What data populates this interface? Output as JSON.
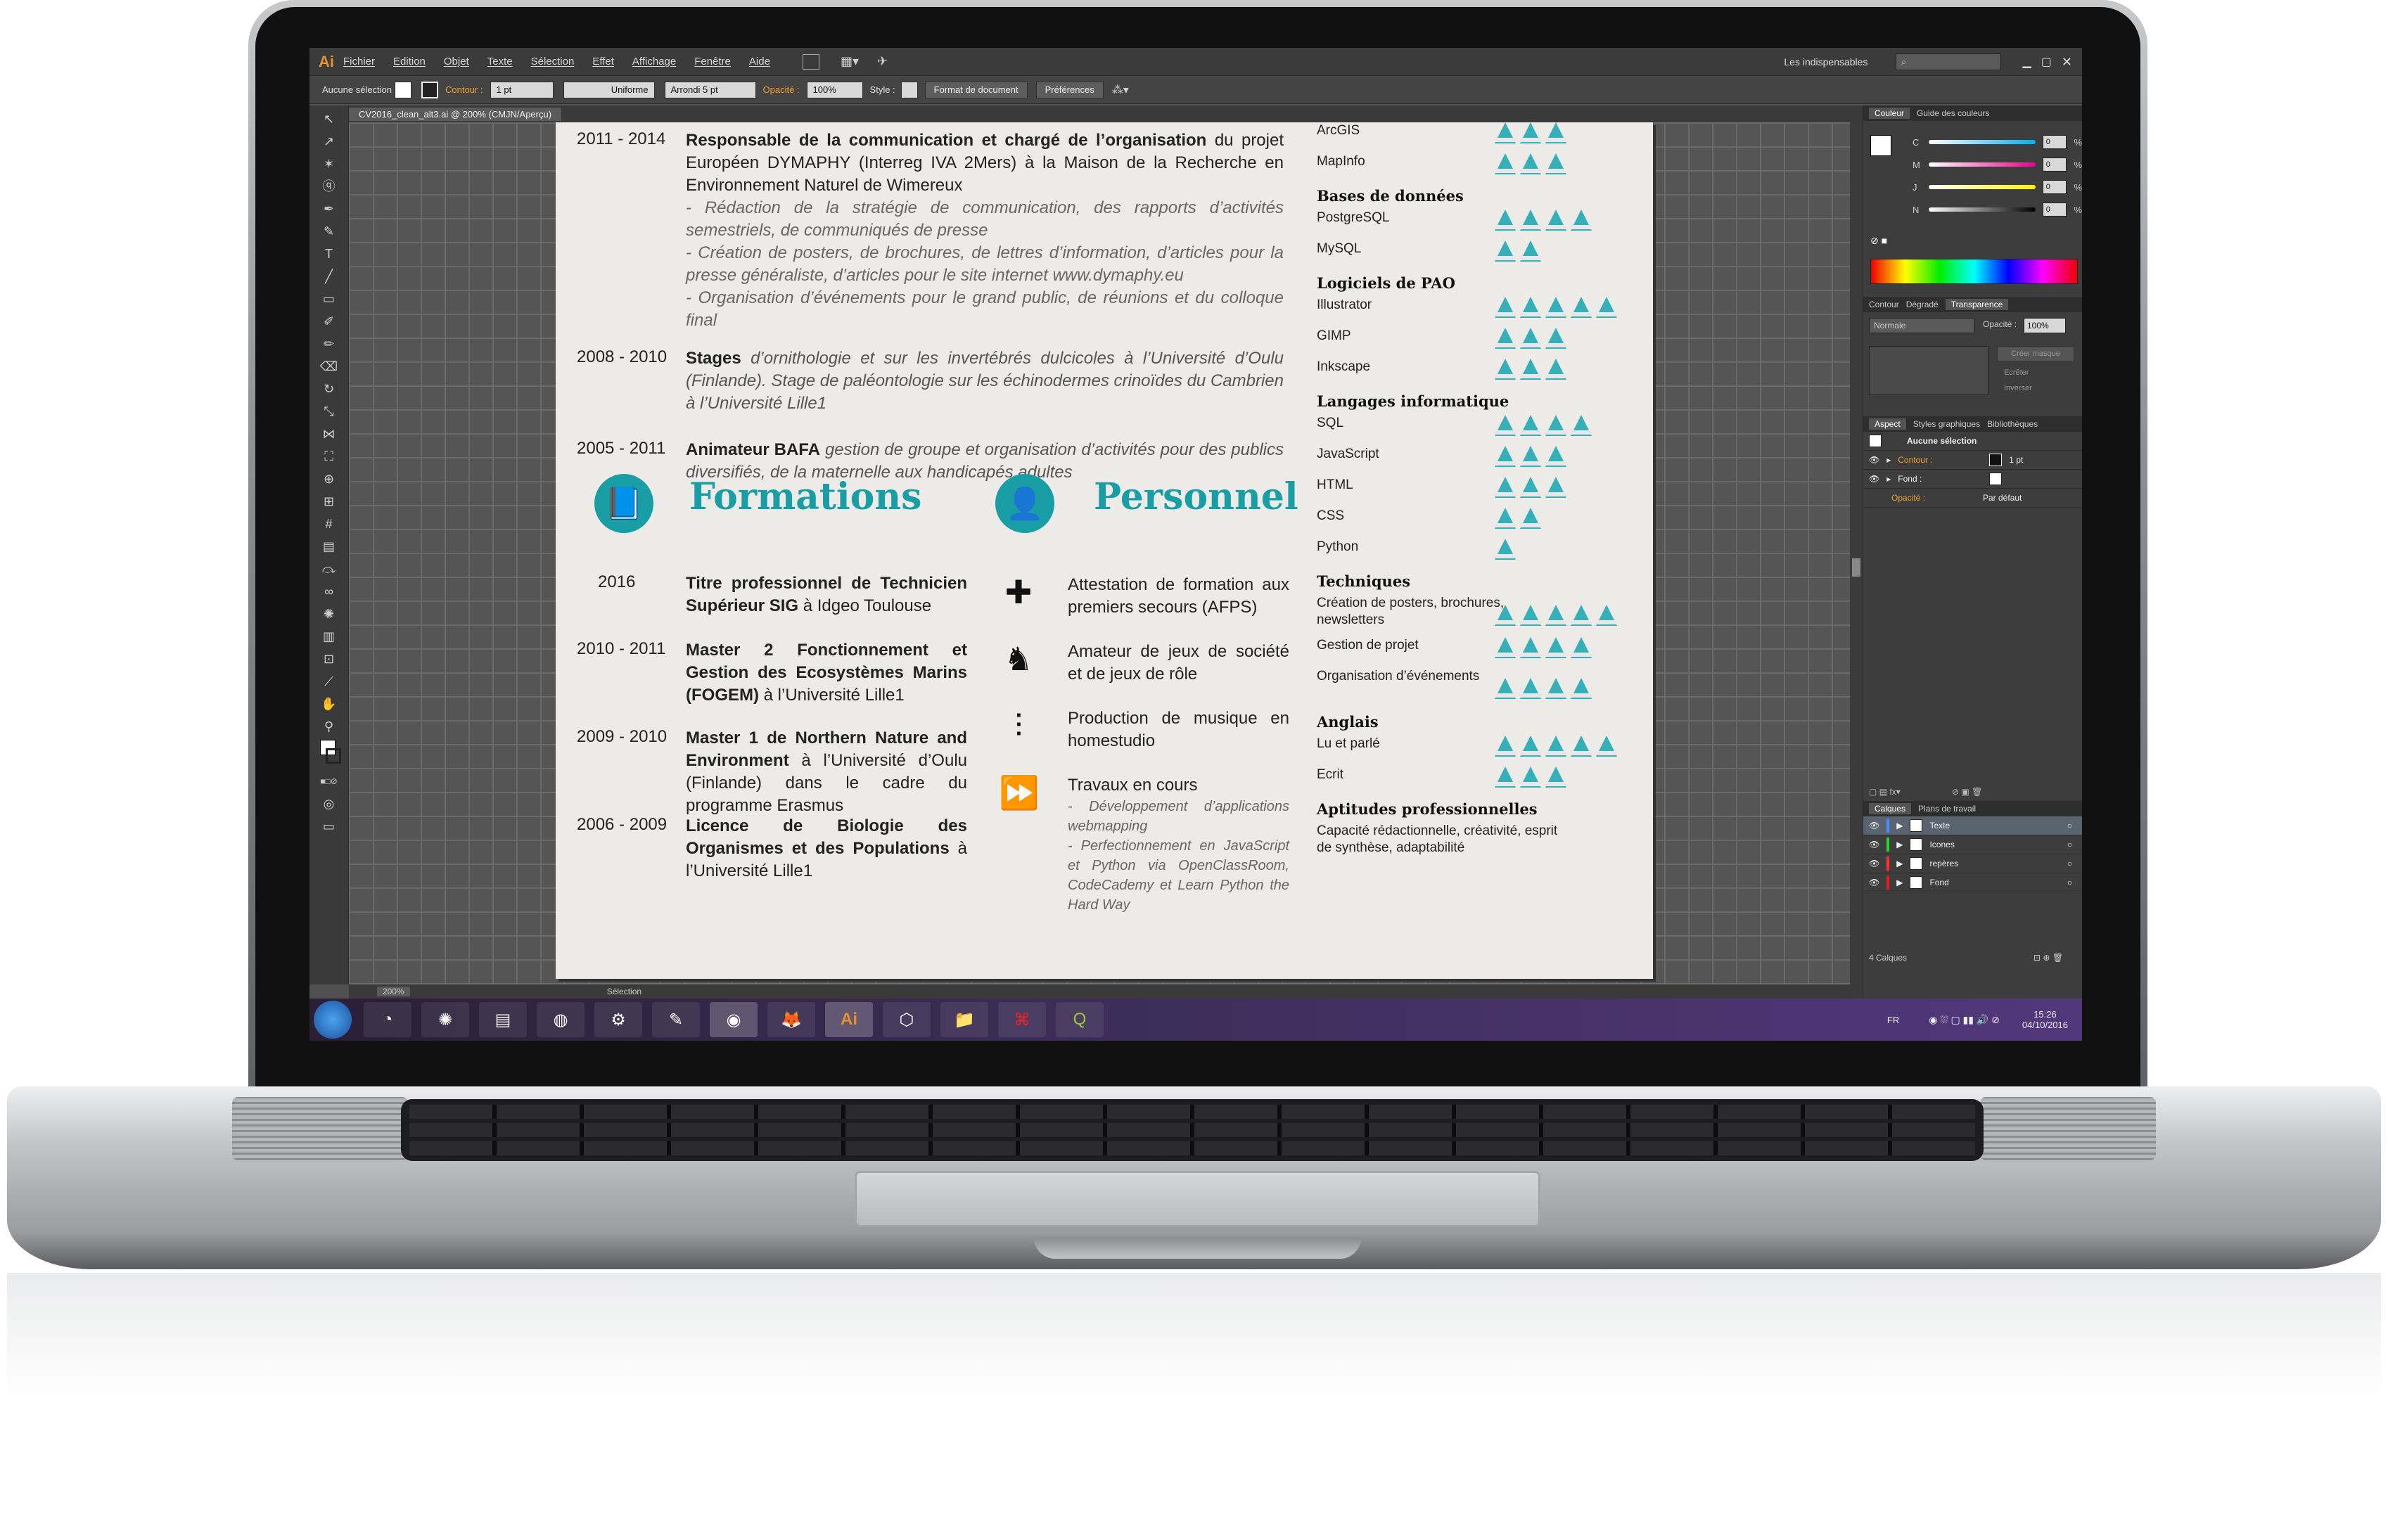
{
  "app": {
    "logo": "Ai",
    "menu": [
      "Fichier",
      "Edition",
      "Objet",
      "Texte",
      "Sélection",
      "Effet",
      "Affichage",
      "Fenêtre",
      "Aide"
    ],
    "workspace": "Les indispensables"
  },
  "control": {
    "selection": "Aucune sélection",
    "stroke_label": "Contour :",
    "stroke_weight": "1 pt",
    "profile": "Uniforme",
    "brush": "Arrondi 5 pt",
    "opacity_label": "Opacité :",
    "opacity": "100%",
    "style_label": "Style :",
    "doc_button": "Format de document",
    "prefs_button": "Préférences"
  },
  "document": {
    "tab": "CV2016_clean_alt3.ai @ 200% (CMJN/Aperçu)"
  },
  "status": {
    "zoom": "200%",
    "tool": "Sélection"
  },
  "cv": {
    "experience": [
      {
        "years": "2011 - 2014",
        "bold": "Responsable de la communication et chargé de l’organisation",
        "text": " du projet Européen DYMAPHY (Interreg IVA 2Mers) à la Maison de la Recherche en Environnement Naturel de Wimereux",
        "details": [
          "- Rédaction de la stratégie de communication, des rapports d’activités semestriels, de communiqués de presse",
          "- Création de posters, de brochures, de lettres d’information, d’articles pour la presse généraliste, d’articles pour le site internet www.dymaphy.eu",
          "- Organisation d’événements pour le grand public, de réunions et du colloque final"
        ]
      },
      {
        "years": "2008 - 2010",
        "bold": "Stages",
        "text": " d’ornithologie et sur les invertébrés dulcicoles à l’Université d’Oulu (Finlande). Stage de paléontologie sur les échinodermes crinoïdes du Cambrien à l’Université Lille1",
        "details": []
      },
      {
        "years": "2005 - 2011",
        "bold": "Animateur BAFA",
        "text": " gestion de groupe et organisation d’activités pour des publics diversifiés, de la maternelle aux handicapés adultes",
        "details": []
      }
    ],
    "formations_title": "Formations",
    "formations": [
      {
        "years": "2016",
        "bold": "Titre professionnel de Technicien Supérieur SIG",
        "text": " à Idgeo Toulouse"
      },
      {
        "years": "2010 - 2011",
        "bold": "Master 2 Fonctionnement et Gestion des Ecosystèmes Marins (FOGEM)",
        "text": " à l’Université Lille1"
      },
      {
        "years": "2009 - 2010",
        "bold": "Master 1 de Northern Nature and Environment",
        "text": " à l’Université d’Oulu (Finlande) dans le cadre du programme Erasmus"
      },
      {
        "years": "2006 - 2009",
        "bold": "Licence de Biologie des Organismes et des Populations",
        "text": " à l’Université Lille1"
      }
    ],
    "personnel_title": "Personnel",
    "personnel": [
      {
        "icon": "first-aid-icon",
        "text": "Attestation de formation aux premiers secours (AFPS)"
      },
      {
        "icon": "chess-knight-icon",
        "text": "Amateur de jeux de société et de jeux de rôle"
      },
      {
        "icon": "mixer-icon",
        "text": "Production de musique en homestudio"
      },
      {
        "icon": "fast-forward-icon",
        "text": "Travaux en cours",
        "details": [
          "- Développement d’applications webmapping",
          "- Perfectionnement en JavaScript et Python via OpenClassRoom, CodeCademy et Learn Python the Hard Way"
        ]
      }
    ],
    "skills": [
      {
        "type": "item",
        "label": "ArcGIS",
        "level": 3
      },
      {
        "type": "item",
        "label": "MapInfo",
        "level": 3
      },
      {
        "type": "heading",
        "label": "Bases de données"
      },
      {
        "type": "item",
        "label": "PostgreSQL",
        "level": 4
      },
      {
        "type": "item",
        "label": "MySQL",
        "level": 2
      },
      {
        "type": "heading",
        "label": "Logiciels de PAO"
      },
      {
        "type": "item",
        "label": "Illustrator",
        "level": 5
      },
      {
        "type": "item",
        "label": "GIMP",
        "level": 3
      },
      {
        "type": "item",
        "label": "Inkscape",
        "level": 3
      },
      {
        "type": "heading",
        "label": "Langages informatique"
      },
      {
        "type": "item",
        "label": "SQL",
        "level": 4
      },
      {
        "type": "item",
        "label": "JavaScript",
        "level": 3
      },
      {
        "type": "item",
        "label": "HTML",
        "level": 3
      },
      {
        "type": "item",
        "label": "CSS",
        "level": 2
      },
      {
        "type": "item",
        "label": "Python",
        "level": 1
      },
      {
        "type": "heading",
        "label": "Techniques"
      },
      {
        "type": "item",
        "label": "Création de posters, brochures, newsletters",
        "level": 5
      },
      {
        "type": "item",
        "label": "Gestion de projet",
        "level": 4
      },
      {
        "type": "item",
        "label": "Organisation d’événements",
        "level": 4
      },
      {
        "type": "heading",
        "label": "Anglais"
      },
      {
        "type": "item",
        "label": "Lu et parlé",
        "level": 5
      },
      {
        "type": "item",
        "label": "Ecrit",
        "level": 3
      },
      {
        "type": "heading",
        "label": "Aptitudes professionnelles"
      },
      {
        "type": "text",
        "label": "Capacité rédactionnelle, créativité, esprit de synthèse, adaptabilité"
      }
    ]
  },
  "panels": {
    "color_tabs": [
      "Couleur",
      "Guide des couleurs"
    ],
    "channels": [
      {
        "label": "C",
        "value": "0",
        "grad": "linear-gradient(90deg,#fff,#00aeef)"
      },
      {
        "label": "M",
        "value": "0",
        "grad": "linear-gradient(90deg,#fff,#ec008c)"
      },
      {
        "label": "J",
        "value": "0",
        "grad": "linear-gradient(90deg,#fff,#fff200)"
      },
      {
        "label": "N",
        "value": "0",
        "grad": "linear-gradient(90deg,#fff,#000)"
      }
    ],
    "transp_tabs": [
      "Contour",
      "Dégradé",
      "Transparence"
    ],
    "blend": "Normale",
    "opacity_label": "Opacité :",
    "opacity": "100%",
    "mask_btn": "Créer masque",
    "clip": "Ecrêter",
    "invert": "Inverser",
    "aspect_tabs": [
      "Aspect",
      "Styles graphiques",
      "Bibliothèques"
    ],
    "aspect": {
      "title": "Aucune sélection",
      "stroke": "Contour :",
      "stroke_val": "1 pt",
      "fill": "Fond :",
      "opacity": "Opacité :",
      "opacity_val": "Par défaut"
    },
    "layer_tabs": [
      "Calques",
      "Plans de travail"
    ],
    "layers": [
      "Texte",
      "Icones",
      "repères",
      "Fond"
    ],
    "layer_count": "4 Calques"
  },
  "taskbar": {
    "lang": "FR",
    "time": "15:26",
    "date": "04/10/2016"
  }
}
